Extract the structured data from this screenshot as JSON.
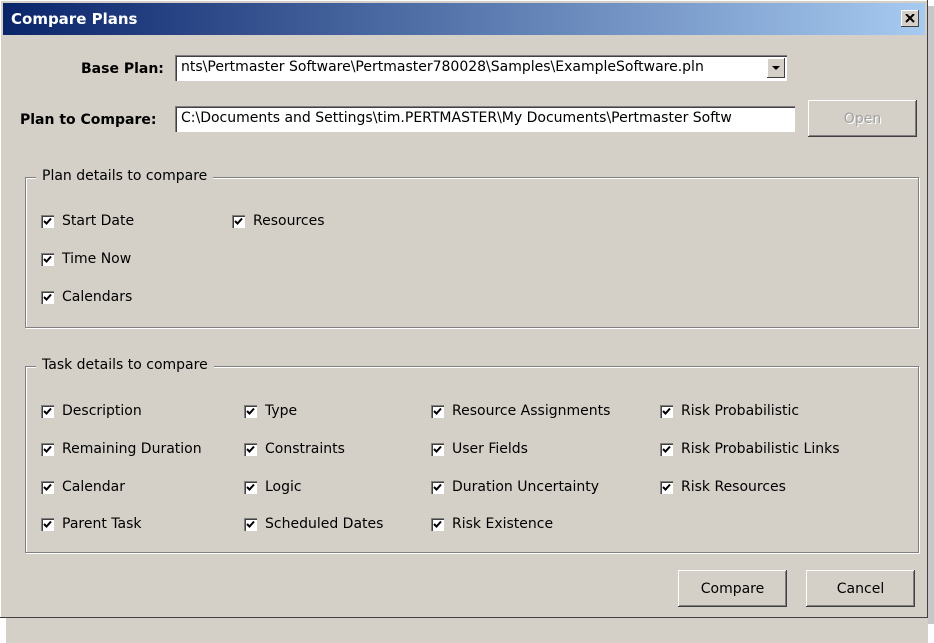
{
  "window": {
    "title": "Compare Plans"
  },
  "base_plan": {
    "label": "Base Plan:",
    "value": "nts\\Pertmaster Software\\Pertmaster780028\\Samples\\ExampleSoftware.pln"
  },
  "compare_plan": {
    "label": "Plan to Compare:",
    "value": "C:\\Documents and Settings\\tim.PERTMASTER\\My Documents\\Pertmaster Softw"
  },
  "open_button": "Open",
  "plan_details": {
    "title": "Plan details to compare",
    "items": [
      {
        "label": "Start Date",
        "checked": true
      },
      {
        "label": "Resources",
        "checked": true
      },
      {
        "label": "Time Now",
        "checked": true
      },
      {
        "label": "Calendars",
        "checked": true
      }
    ]
  },
  "task_details": {
    "title": "Task details to compare",
    "items": [
      {
        "label": "Description",
        "checked": true
      },
      {
        "label": "Remaining Duration",
        "checked": true
      },
      {
        "label": "Calendar",
        "checked": true
      },
      {
        "label": "Parent Task",
        "checked": true
      },
      {
        "label": "Type",
        "checked": true
      },
      {
        "label": "Constraints",
        "checked": true
      },
      {
        "label": "Logic",
        "checked": true
      },
      {
        "label": "Scheduled Dates",
        "checked": true
      },
      {
        "label": "Resource Assignments",
        "checked": true
      },
      {
        "label": "User Fields",
        "checked": true
      },
      {
        "label": "Duration Uncertainty",
        "checked": true
      },
      {
        "label": "Risk Existence",
        "checked": true
      },
      {
        "label": "Risk Probabilistic",
        "checked": true
      },
      {
        "label": "Risk Probabilistic Links",
        "checked": true
      },
      {
        "label": "Risk Resources",
        "checked": true
      }
    ]
  },
  "buttons": {
    "compare": "Compare",
    "cancel": "Cancel"
  }
}
